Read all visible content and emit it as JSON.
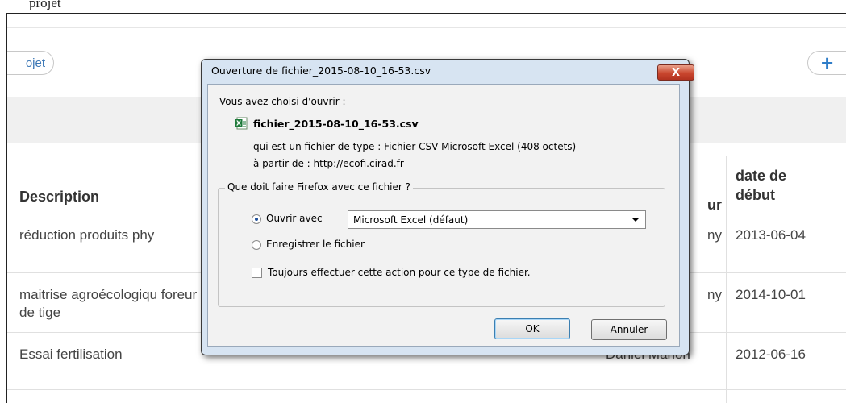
{
  "header": {
    "partial_text": "projet"
  },
  "toolbar": {
    "project_button_label": "ojet",
    "add_icon": "plus-icon"
  },
  "table": {
    "headers": {
      "description": "Description",
      "author_partial": "ur",
      "start_date": "date de début"
    },
    "rows": [
      {
        "description": "réduction produits phy",
        "author": "ny",
        "start_date": "2013-06-04"
      },
      {
        "description": "maitrise agroécologiqu foreur de tige",
        "author": "ny",
        "start_date": "2014-10-01"
      },
      {
        "description": "Essai fertilisation",
        "author": "Daniel Marion",
        "start_date": "2012-06-16"
      }
    ]
  },
  "dialog": {
    "title": "Ouverture de fichier_2015-08-10_16-53.csv",
    "close_label": "X",
    "intro": "Vous avez choisi d'ouvrir :",
    "file_name": "fichier_2015-08-10_16-53.csv",
    "file_type_line": "qui est un fichier de type : Fichier CSV Microsoft Excel (408 octets)",
    "source_line": "à partir de : http://ecofi.cirad.fr",
    "question": "Que doit faire Firefox avec ce fichier ?",
    "open_with_label": "Ouvrir avec",
    "open_with_value": "Microsoft Excel (défaut)",
    "save_label": "Enregistrer le fichier",
    "always_label": "Toujours effectuer cette action pour ce type de fichier.",
    "ok_label": "OK",
    "cancel_label": "Annuler",
    "open_with_selected": true,
    "always_checked": false
  }
}
